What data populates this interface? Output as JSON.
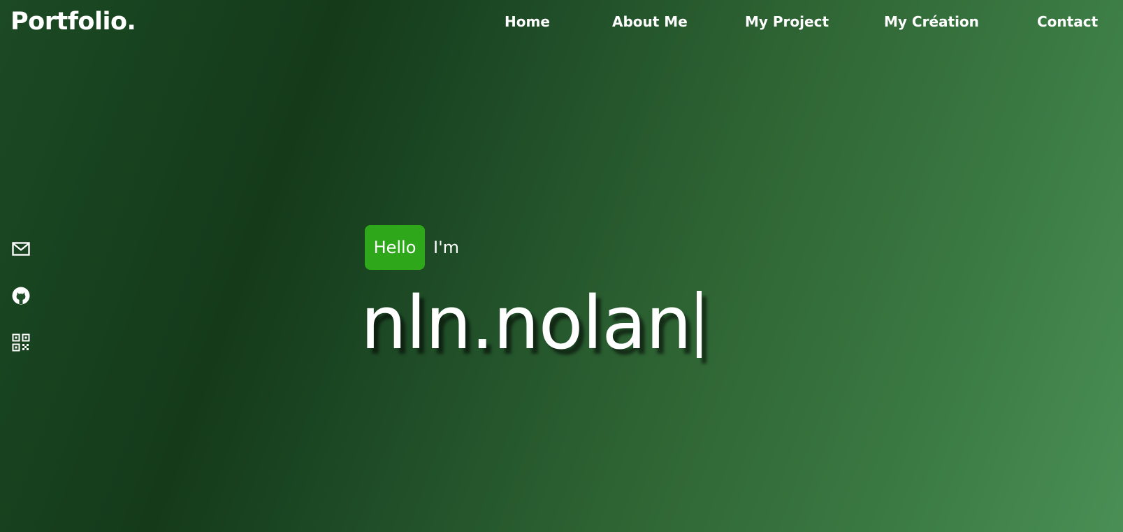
{
  "brand": {
    "logo_text": "Portfolio."
  },
  "nav": {
    "items": [
      {
        "label": "Home"
      },
      {
        "label": "About Me"
      },
      {
        "label": "My Project"
      },
      {
        "label": "My Création"
      },
      {
        "label": "Contact"
      }
    ]
  },
  "social": {
    "icons": [
      "mail-icon",
      "github-icon",
      "qr-code-icon"
    ]
  },
  "hero": {
    "badge_text": "Hello",
    "intro_text": "I'm",
    "name_text": "nln.nolan",
    "badge_color": "#2ea81a"
  },
  "colors": {
    "background_dark": "#143a1a",
    "background_light": "#4a8f55",
    "text": "#ffffff"
  }
}
